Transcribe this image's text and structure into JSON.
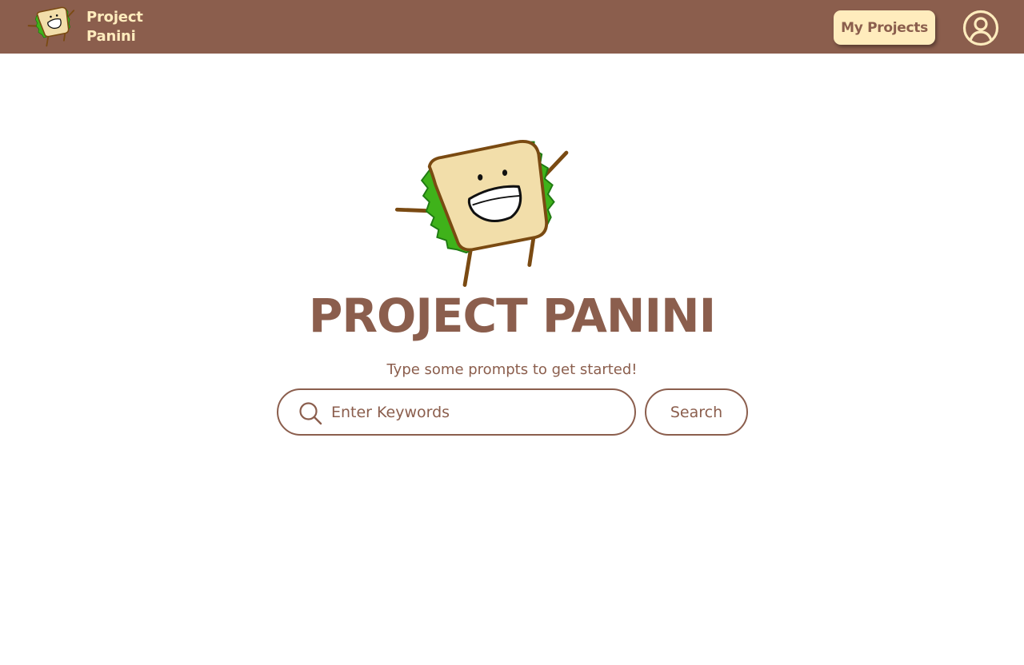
{
  "header": {
    "brand_line1": "Project",
    "brand_line2": "Panini",
    "my_projects_label": "My Projects",
    "logo_icon": "sandwich-mascot-icon",
    "account_icon": "user-account-icon"
  },
  "hero": {
    "title": "PROJECT PANINI",
    "subtitle": "Type some prompts to get started!",
    "mascot_icon": "sandwich-mascot-icon"
  },
  "search": {
    "placeholder": "Enter Keywords",
    "value": "",
    "button_label": "Search",
    "icon": "search-icon"
  },
  "colors": {
    "brand_brown": "#8b5e4d",
    "cream": "#ffecbd",
    "bread": "#f2deaa",
    "crust": "#7a4a12",
    "lettuce": "#3fb21a",
    "background": "#ffffff"
  }
}
